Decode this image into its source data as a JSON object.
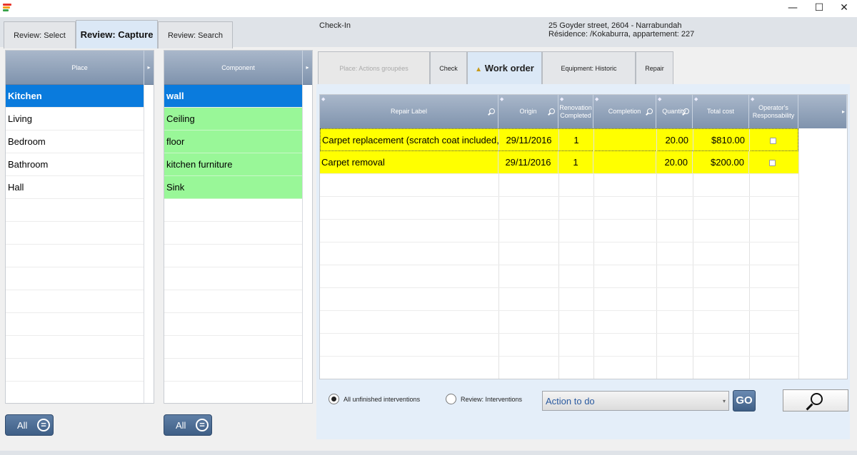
{
  "window": {
    "minimize": "—",
    "maximize": "☐",
    "close": "✕"
  },
  "tabs": [
    {
      "label": "Review: Select"
    },
    {
      "label": "Review: Capture"
    },
    {
      "label": "Review: Search"
    }
  ],
  "header": {
    "mode": "Check-In",
    "address_line1": "25 Goyder street, 2604 - Narrabundah",
    "address_line2": "Résidence: /Kokaburra, appartement: 227"
  },
  "place_list": {
    "header": "Place",
    "items": [
      "Kitchen",
      "Living",
      "Bedroom",
      "Bathroom",
      "Hall"
    ],
    "all_label": "All"
  },
  "component_list": {
    "header": "Component",
    "items": [
      "wall",
      "Ceiling",
      "floor",
      "kitchen furniture",
      "Sink"
    ],
    "all_label": "All"
  },
  "right_tabs": [
    {
      "label": "Place: Actions groupées"
    },
    {
      "label": "Check"
    },
    {
      "label": "Work order"
    },
    {
      "label": "Equipment: Historic"
    },
    {
      "label": "Repair"
    }
  ],
  "grid": {
    "columns": [
      {
        "label": "Repair Label"
      },
      {
        "label": "Origin"
      },
      {
        "label": "Renovation Completed"
      },
      {
        "label": "Completion"
      },
      {
        "label": "Quantity"
      },
      {
        "label": "Total cost"
      },
      {
        "label": "Operator's Responsability"
      }
    ],
    "rows": [
      {
        "label": "Carpet replacement (scratch coat included, re",
        "origin": "29/11/2016",
        "renovation": "1",
        "completion": "",
        "quantity": "20.00",
        "total": "$810.00",
        "operator_resp": false
      },
      {
        "label": "Carpet removal",
        "origin": "29/11/2016",
        "renovation": "1",
        "completion": "",
        "quantity": "20.00",
        "total": "$200.00",
        "operator_resp": false
      }
    ]
  },
  "filters": {
    "option1": "All unfinished interventions",
    "option2": "Review: Interventions",
    "selected": "All unfinished interventions"
  },
  "action": {
    "placeholder": "Action to do",
    "go_label": "GO"
  },
  "colors": {
    "selected_row": "#0a7bdd",
    "component_green": "#99f798",
    "grid_highlight": "#ffff00",
    "header_blue": "#7f93ad"
  }
}
